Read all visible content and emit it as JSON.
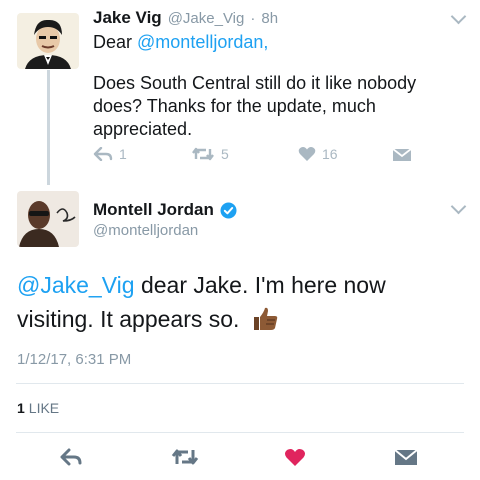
{
  "reply_tweet": {
    "author_name": "Jake Vig",
    "handle": "@Jake_Vig",
    "separator": "·",
    "time": "8h",
    "salutation_word": "Dear",
    "mention": "@montelljordan,",
    "body": "Does South Central still do it like nobody does? Thanks for the update, much appreciated.",
    "actions": {
      "reply_count": "1",
      "retweet_count": "5",
      "like_count": "16"
    }
  },
  "main_tweet": {
    "author_name": "Montell Jordan",
    "handle": "@montelljordan",
    "mention": "@Jake_Vig",
    "text": " dear Jake. I'm here now visiting. It appears so.",
    "timestamp": "1/12/17, 6:31 PM",
    "likes_number": "1",
    "likes_label": "LIKE"
  },
  "colors": {
    "link": "#1da1f2",
    "like_red": "#e0245e",
    "verified_blue": "#1da1f2",
    "icon_gray": "#aab8c2",
    "action_dark": "#657786"
  },
  "icons": [
    "reply-icon",
    "retweet-icon",
    "heart-icon",
    "direct-message-icon",
    "chevron-down-icon",
    "verified-badge-icon",
    "thumbs-up-emoji"
  ]
}
